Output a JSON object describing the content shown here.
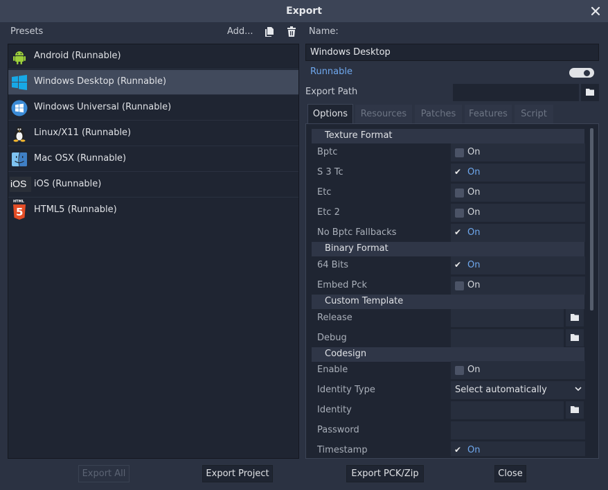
{
  "window": {
    "title": "Export"
  },
  "presets": {
    "header": "Presets",
    "add_label": "Add...",
    "items": [
      {
        "label": "Android (Runnable)",
        "icon": "android-icon"
      },
      {
        "label": "Windows Desktop (Runnable)",
        "icon": "windows-icon"
      },
      {
        "label": "Windows Universal (Runnable)",
        "icon": "windows-universal-icon"
      },
      {
        "label": "Linux/X11 (Runnable)",
        "icon": "linux-icon"
      },
      {
        "label": "Mac OSX (Runnable)",
        "icon": "mac-osx-icon"
      },
      {
        "label": "iOS (Runnable)",
        "icon": "ios-icon",
        "badge": "iOS"
      },
      {
        "label": "HTML5 (Runnable)",
        "icon": "html5-icon",
        "badge": "HTML",
        "badge2": "5"
      }
    ],
    "selected_index": 1
  },
  "details": {
    "name_label": "Name:",
    "name_value": "Windows Desktop",
    "runnable_label": "Runnable",
    "runnable_on": true,
    "export_path_label": "Export Path",
    "export_path_value": ""
  },
  "tabs": [
    "Options",
    "Resources",
    "Patches",
    "Features",
    "Script"
  ],
  "active_tab": 0,
  "options": {
    "on_text": "On",
    "texture_format": "Texture Format",
    "bptc": {
      "label": "Bptc",
      "checked": false
    },
    "s3tc": {
      "label": "S 3 Tc",
      "checked": true
    },
    "etc": {
      "label": "Etc",
      "checked": false
    },
    "etc2": {
      "label": "Etc 2",
      "checked": false
    },
    "no_bptc_fallbacks": {
      "label": "No Bptc Fallbacks",
      "checked": true
    },
    "binary_format": "Binary Format",
    "bits64": {
      "label": "64 Bits",
      "checked": true
    },
    "embed_pck": {
      "label": "Embed Pck",
      "checked": false
    },
    "custom_template": "Custom Template",
    "release": {
      "label": "Release",
      "value": ""
    },
    "debug": {
      "label": "Debug",
      "value": ""
    },
    "codesign": "Codesign",
    "enable": {
      "label": "Enable",
      "checked": false
    },
    "identity_type": {
      "label": "Identity Type",
      "value": "Select automatically"
    },
    "identity": {
      "label": "Identity",
      "value": ""
    },
    "password": {
      "label": "Password",
      "value": ""
    },
    "timestamp": {
      "label": "Timestamp",
      "checked": true
    }
  },
  "buttons": {
    "export_all": "Export All",
    "export_project": "Export Project",
    "export_pck_zip": "Export PCK/Zip",
    "close": "Close"
  },
  "colors": {
    "accent": "#6fa8ee",
    "background": "#2b3242",
    "panel": "#1f2532",
    "selected": "#414a5c"
  }
}
